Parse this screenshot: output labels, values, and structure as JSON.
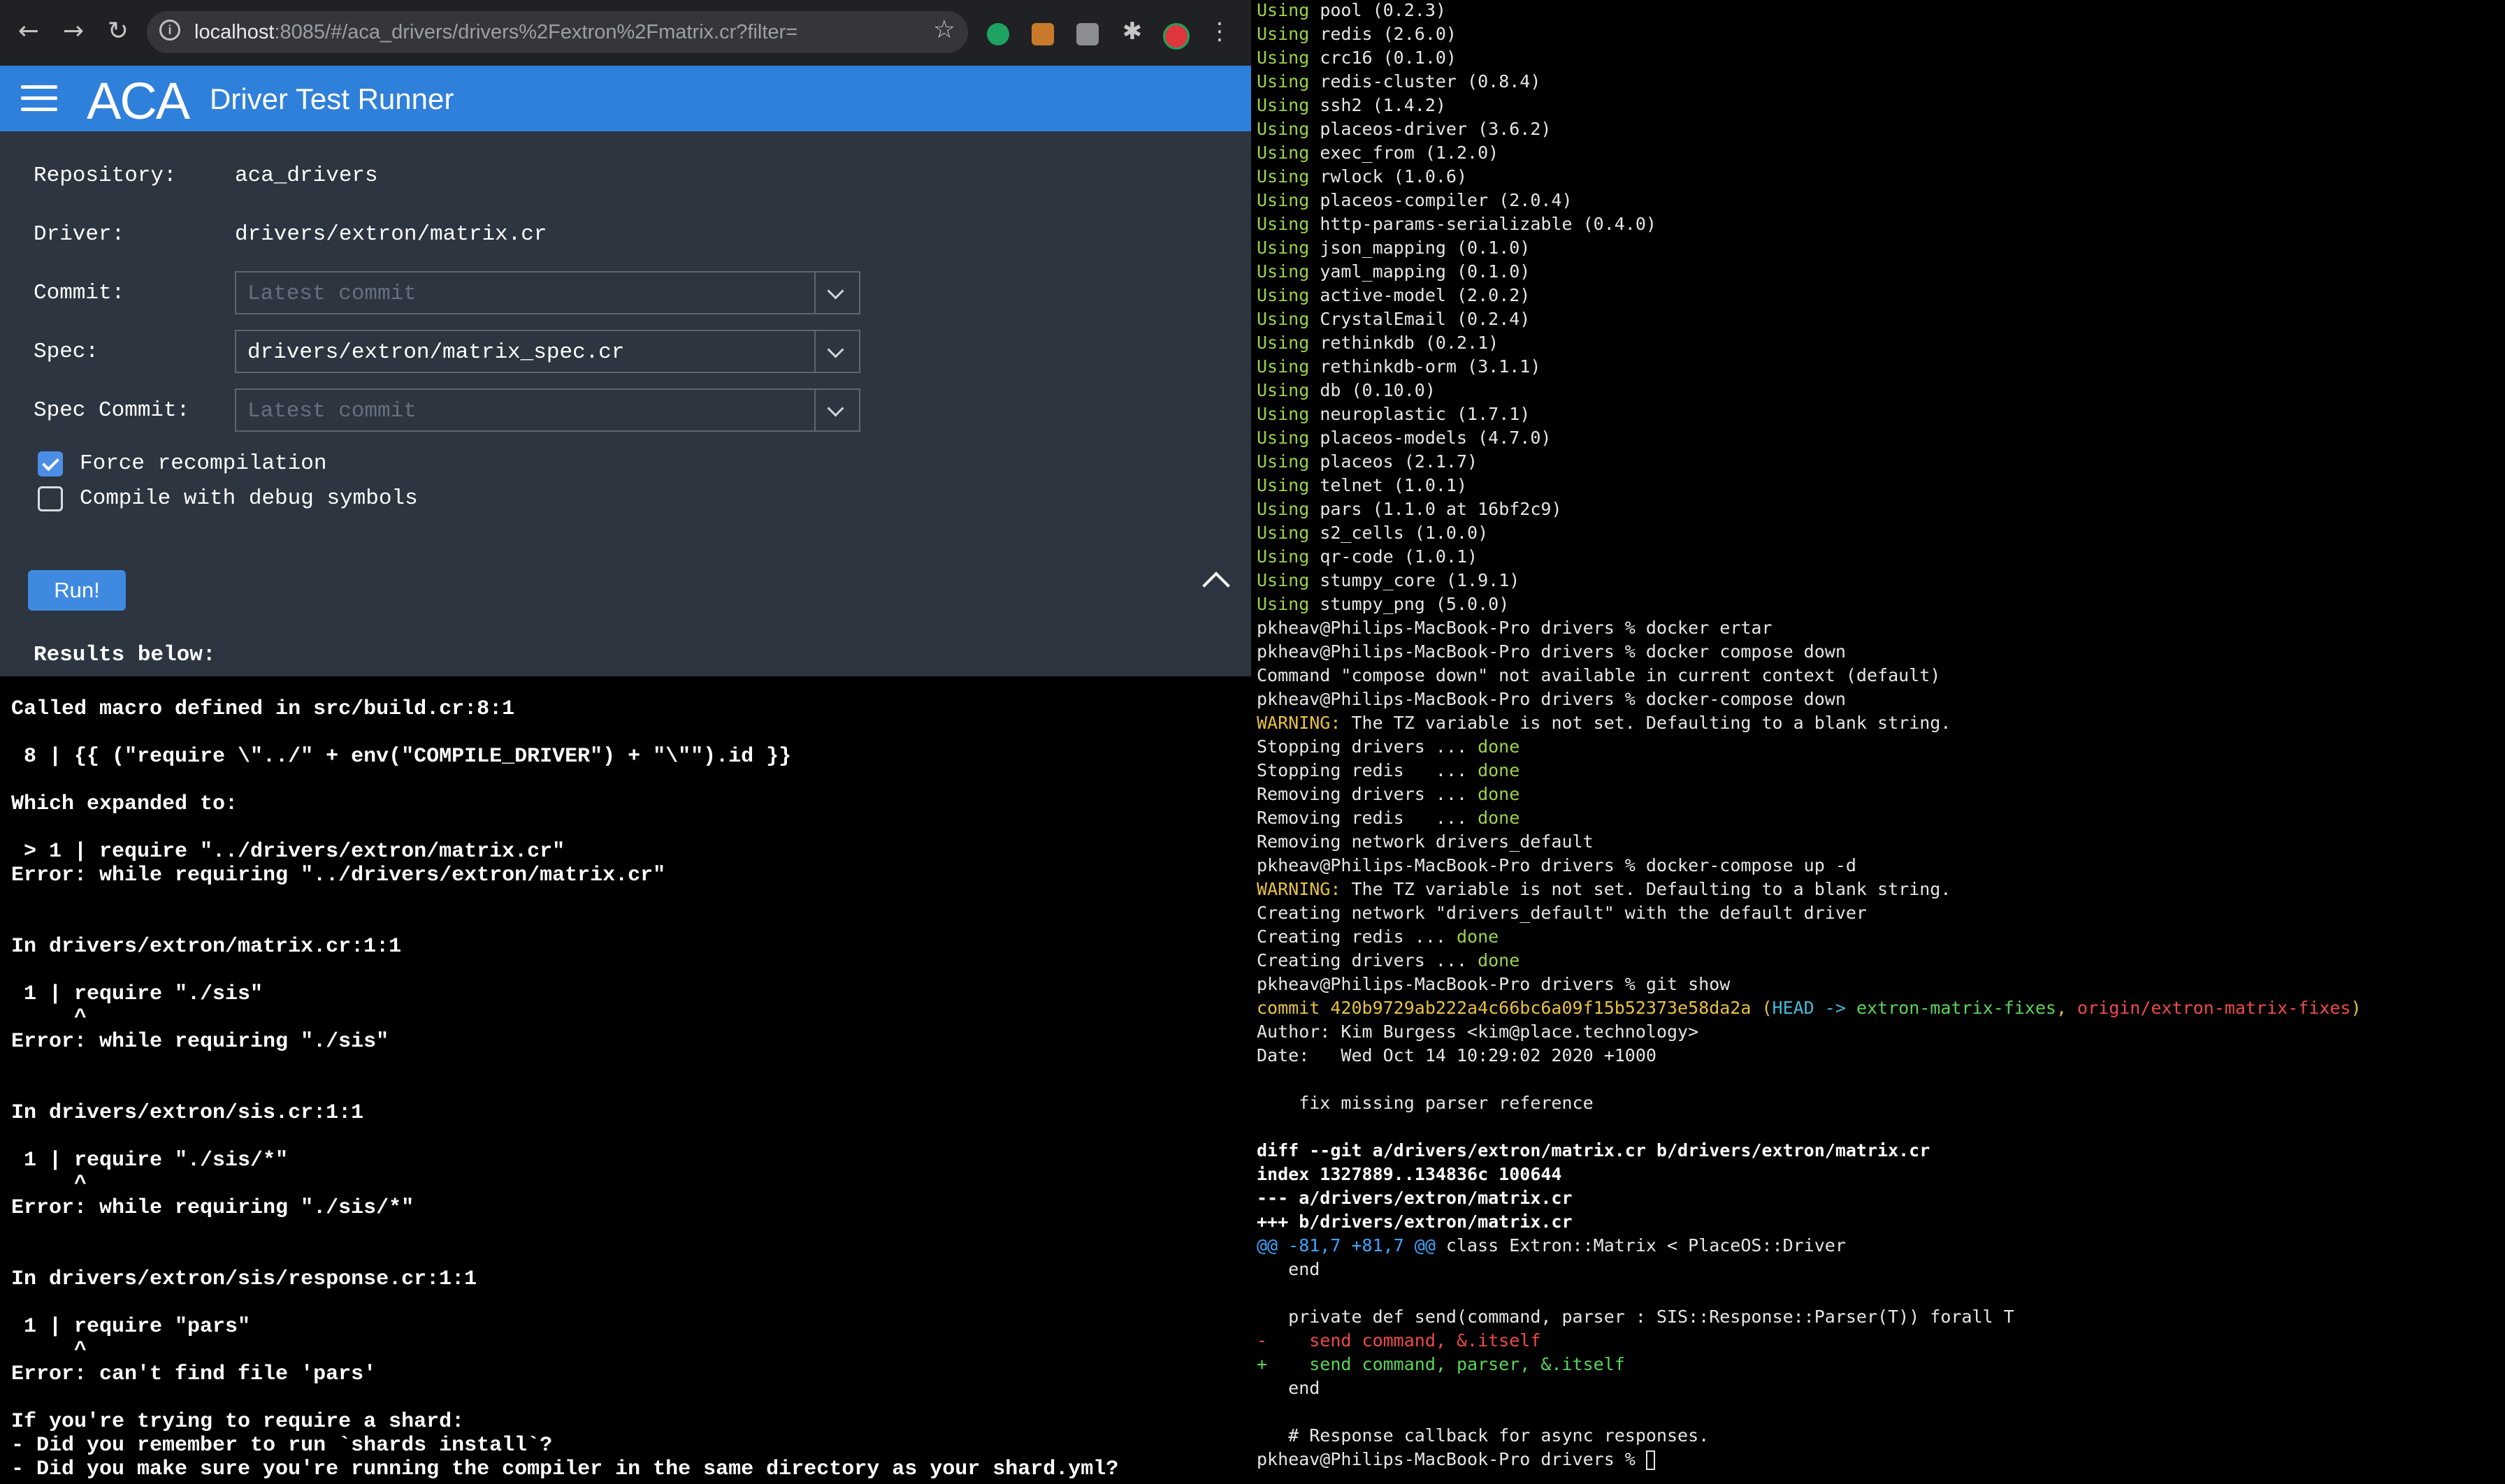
{
  "browser": {
    "url_host": "localhost",
    "url_rest": ":8085/#/aca_drivers/drivers%2Fextron%2Fmatrix.cr?filter=",
    "icons": [
      "back-arrow-icon",
      "forward-arrow-icon",
      "reload-icon",
      "info-icon",
      "star-icon",
      "extensions-puzzle-icon",
      "kebab-menu-icon"
    ]
  },
  "app": {
    "logo": "ACA",
    "title": "Driver Test Runner",
    "accent": "#2f80da"
  },
  "form": {
    "repository_label": "Repository:",
    "repository_value": "aca_drivers",
    "driver_label": "Driver:",
    "driver_value": "drivers/extron/matrix.cr",
    "commit_label": "Commit:",
    "commit_placeholder": "Latest commit",
    "spec_label": "Spec:",
    "spec_value": "drivers/extron/matrix_spec.cr",
    "spec_commit_label": "Spec Commit:",
    "spec_commit_placeholder": "Latest commit",
    "force_recompilation_label": "Force recompilation",
    "force_recompilation_checked": true,
    "debug_symbols_label": "Compile with debug symbols",
    "debug_symbols_checked": false
  },
  "run": {
    "button_label": "Run!",
    "results_label": "Results below:"
  },
  "results_text": "Called macro defined in src/build.cr:8:1\n\n 8 | {{ (\"require \\\"../\" + env(\"COMPILE_DRIVER\") + \"\\\"\").id }}\n\nWhich expanded to:\n\n > 1 | require \"../drivers/extron/matrix.cr\"\nError: while requiring \"../drivers/extron/matrix.cr\"\n\n\nIn drivers/extron/matrix.cr:1:1\n\n 1 | require \"./sis\"\n     ^\nError: while requiring \"./sis\"\n\n\nIn drivers/extron/sis.cr:1:1\n\n 1 | require \"./sis/*\"\n     ^\nError: while requiring \"./sis/*\"\n\n\nIn drivers/extron/sis/response.cr:1:1\n\n 1 | require \"pars\"\n     ^\nError: can't find file 'pars'\n\nIf you're trying to require a shard:\n- Did you remember to run `shards install`?\n- Did you make sure you're running the compiler in the same directory as your shard.yml?",
  "terminal": {
    "using_lines": [
      [
        "Using",
        " pool (0.2.3)"
      ],
      [
        "Using",
        " redis (2.6.0)"
      ],
      [
        "Using",
        " crc16 (0.1.0)"
      ],
      [
        "Using",
        " redis-cluster (0.8.4)"
      ],
      [
        "Using",
        " ssh2 (1.4.2)"
      ],
      [
        "Using",
        " placeos-driver (3.6.2)"
      ],
      [
        "Using",
        " exec_from (1.2.0)"
      ],
      [
        "Using",
        " rwlock (1.0.6)"
      ],
      [
        "Using",
        " placeos-compiler (2.0.4)"
      ],
      [
        "Using",
        " http-params-serializable (0.4.0)"
      ],
      [
        "Using",
        " json_mapping (0.1.0)"
      ],
      [
        "Using",
        " yaml_mapping (0.1.0)"
      ],
      [
        "Using",
        " active-model (2.0.2)"
      ],
      [
        "Using",
        " CrystalEmail (0.2.4)"
      ],
      [
        "Using",
        " rethinkdb (0.2.1)"
      ],
      [
        "Using",
        " rethinkdb-orm (3.1.1)"
      ],
      [
        "Using",
        " db (0.10.0)"
      ],
      [
        "Using",
        " neuroplastic (1.7.1)"
      ],
      [
        "Using",
        " placeos-models (4.7.0)"
      ],
      [
        "Using",
        " placeos (2.1.7)"
      ],
      [
        "Using",
        " telnet (1.0.1)"
      ],
      [
        "Using",
        " pars (1.1.0 at 16bf2c9)"
      ],
      [
        "Using",
        " s2_cells (1.0.0)"
      ],
      [
        "Using",
        " qr-code (1.0.1)"
      ],
      [
        "Using",
        " stumpy_core (1.9.1)"
      ],
      [
        "Using",
        " stumpy_png (5.0.0)"
      ]
    ],
    "prompt": "pkheav@Philips-MacBook-Pro drivers % ",
    "cmd_ertar": "docker ertar",
    "cmd_compose_down": "docker compose down",
    "err_compose_down": "Command \"compose down\" not available in current context (default)",
    "cmd_dc_down": "docker-compose down",
    "warning_label": "WARNING:",
    "warning_text": " The TZ variable is not set. Defaulting to a blank string.",
    "stopping_drivers": "Stopping drivers ... ",
    "stopping_redis": "Stopping redis   ... ",
    "removing_drivers": "Removing drivers ... ",
    "removing_redis": "Removing redis   ... ",
    "done": "done",
    "removing_network": "Removing network drivers_default",
    "cmd_dc_up": "docker-compose up -d",
    "creating_network": "Creating network \"drivers_default\" with the default driver",
    "creating_redis": "Creating redis ... ",
    "creating_drivers": "Creating drivers ... ",
    "cmd_git_show": "git show",
    "commit_label": "commit 420b9729ab222a4c66bc6a09f15b52373e58da2a",
    "head_open": " (",
    "head": "HEAD -> ",
    "branch": "extron-matrix-fixes",
    "comma": ", ",
    "origin_branch": "origin/extron-matrix-fixes",
    "head_close": ")",
    "author": "Author: Kim Burgess <kim@place.technology>",
    "date": "Date:   Wed Oct 14 10:29:02 2020 +1000",
    "message": "    fix missing parser reference",
    "diff_header": "diff --git a/drivers/extron/matrix.cr b/drivers/extron/matrix.cr",
    "index_line": "index 1327889..134836c 100644",
    "minus_file": "--- a/drivers/extron/matrix.cr",
    "plus_file": "+++ b/drivers/extron/matrix.cr",
    "hunk_marker": "@@ -81,7 +81,7 @@",
    "hunk_context": " class Extron::Matrix < PlaceOS::Driver",
    "ctx_end": "   end",
    "ctx_def": "   private def send(command, parser : SIS::Response::Parser(T)) forall T",
    "removed": "-    send command, &.itself",
    "added": "+    send command, parser, &.itself",
    "ctx_end2": "   end",
    "ctx_comment": "   # Response callback for async responses."
  }
}
